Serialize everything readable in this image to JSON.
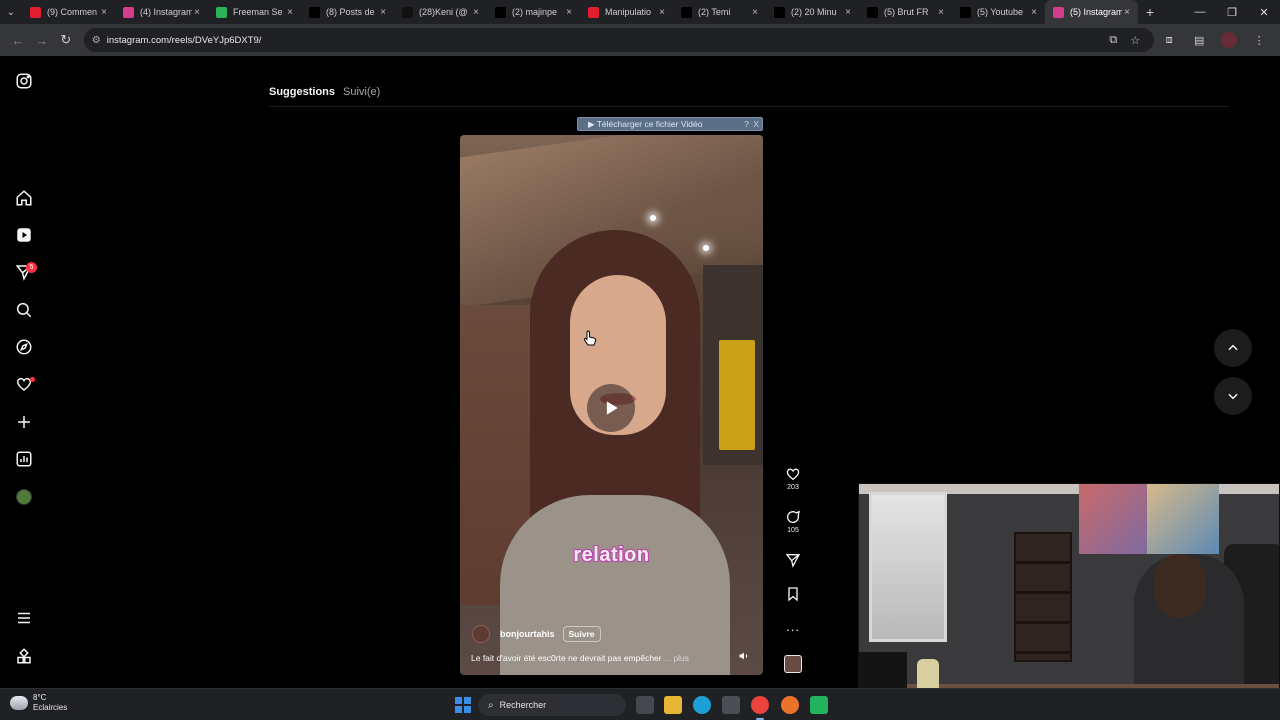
{
  "browser": {
    "tabs": [
      {
        "title": "(9) Commen",
        "favicon": "youtube-icon",
        "color": "#e01e2e"
      },
      {
        "title": "(4) Instagram",
        "favicon": "instagram-icon",
        "color": "#d43c8c"
      },
      {
        "title": "Freeman Se",
        "favicon": "green-app-icon",
        "color": "#2bb35a"
      },
      {
        "title": "(8) Posts de",
        "favicon": "x-icon",
        "color": "#000000"
      },
      {
        "title": "(28)Keni (@",
        "favicon": "tiktok-icon",
        "color": "#111111"
      },
      {
        "title": "(2) majinpe",
        "favicon": "x-icon",
        "color": "#000000"
      },
      {
        "title": "Manipulatio",
        "favicon": "youtube-icon",
        "color": "#e01e2e"
      },
      {
        "title": "(2) Temi",
        "favicon": "x-icon",
        "color": "#000000"
      },
      {
        "title": "(2) 20 Minu",
        "favicon": "x-icon",
        "color": "#000000"
      },
      {
        "title": "(5) Brut FR",
        "favicon": "x-icon",
        "color": "#000000"
      },
      {
        "title": "(5) Youtube",
        "favicon": "x-icon",
        "color": "#000000"
      },
      {
        "title": "(5) Instagram",
        "favicon": "instagram-icon",
        "color": "#d43c8c",
        "active": true
      }
    ],
    "url": "instagram.com/reels/DVeYJp6DXT9/"
  },
  "instagram": {
    "feed_tabs": {
      "suggestions": "Suggestions",
      "following": "Suivi(e)"
    },
    "notification_count": "5",
    "download_banner": {
      "label": "▶ Télécharger ce fichier Vidéo",
      "help": "?",
      "close": "X"
    },
    "reel": {
      "caption_overlay": "relation",
      "username": "bonjourtahis",
      "follow_label": "Suivre",
      "description": "Le fait d'avoir été esc0rte ne devrait pas empêcher",
      "more_label": "... plus"
    },
    "actions": {
      "likes": "203",
      "comments": "105",
      "more": "..."
    }
  },
  "taskbar": {
    "weather_temp": "8°C",
    "weather_desc": "Eclaircies",
    "search_placeholder": "Rechercher"
  },
  "colors": {
    "accent_blue": "#3a8ee8",
    "notification_red": "#ff3040",
    "caption_pink": "#b64aa6"
  }
}
